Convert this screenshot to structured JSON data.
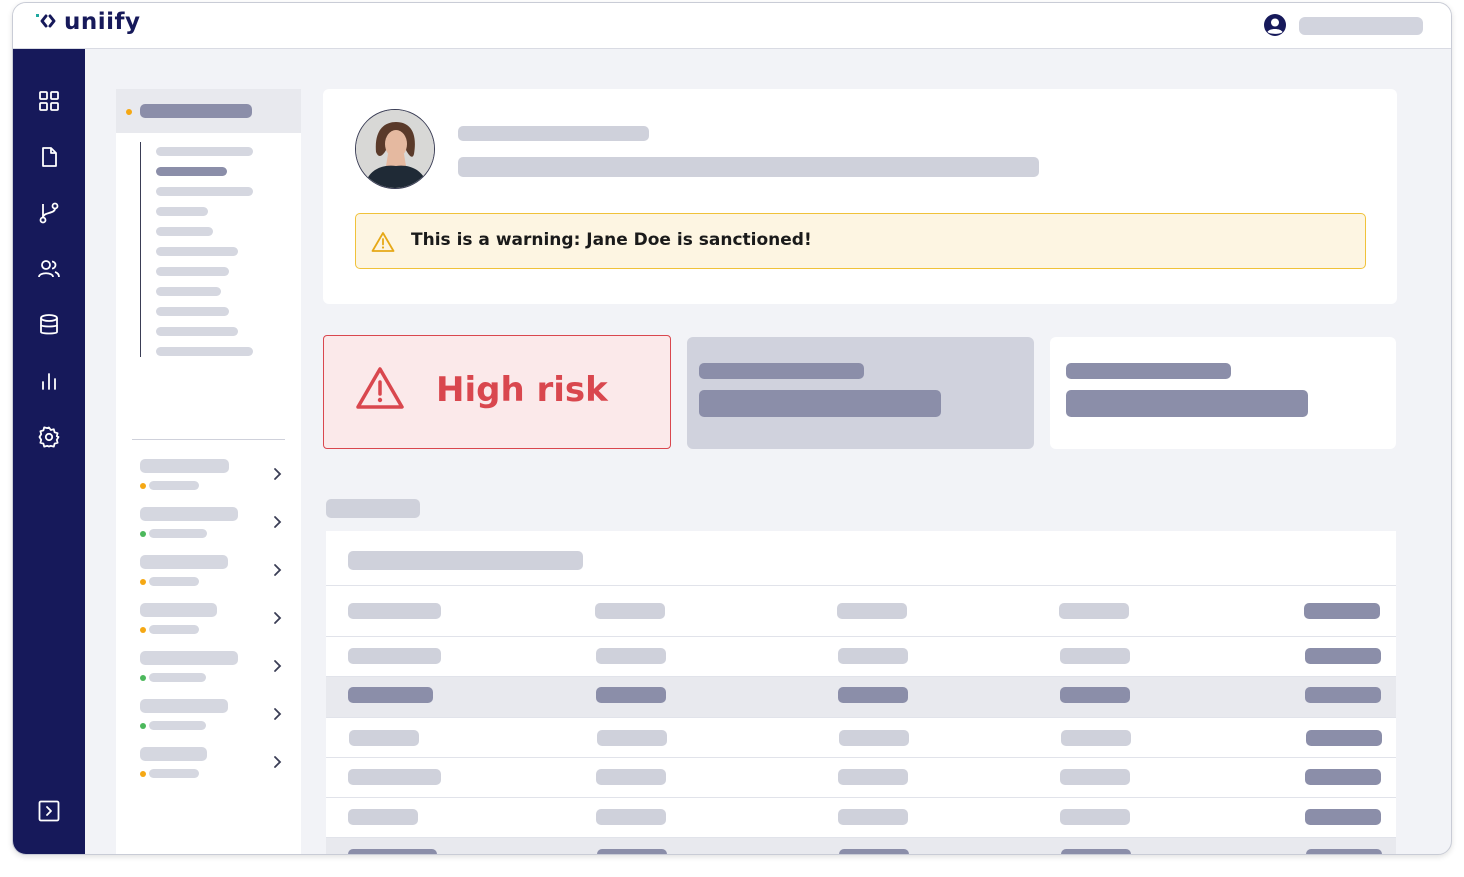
{
  "app": {
    "brand": "uniify"
  },
  "header": {
    "user_icon": "user-circle-icon"
  },
  "sidebar": {
    "icons": [
      "dashboard-grid-icon",
      "document-icon",
      "git-branch-icon",
      "users-icon",
      "database-icon",
      "bar-chart-icon",
      "settings-gear-icon"
    ],
    "expand_icon": "expand-panel-icon"
  },
  "profile": {
    "warning_text": "This is a warning: Jane Doe is sanctioned!"
  },
  "risk": {
    "label": "High risk"
  },
  "colors": {
    "nav_bg": "#16195a",
    "risk_red": "#d9474e",
    "warning_border": "#f0c23a",
    "status_orange": "#f5a814",
    "status_green": "#4cb85c"
  }
}
